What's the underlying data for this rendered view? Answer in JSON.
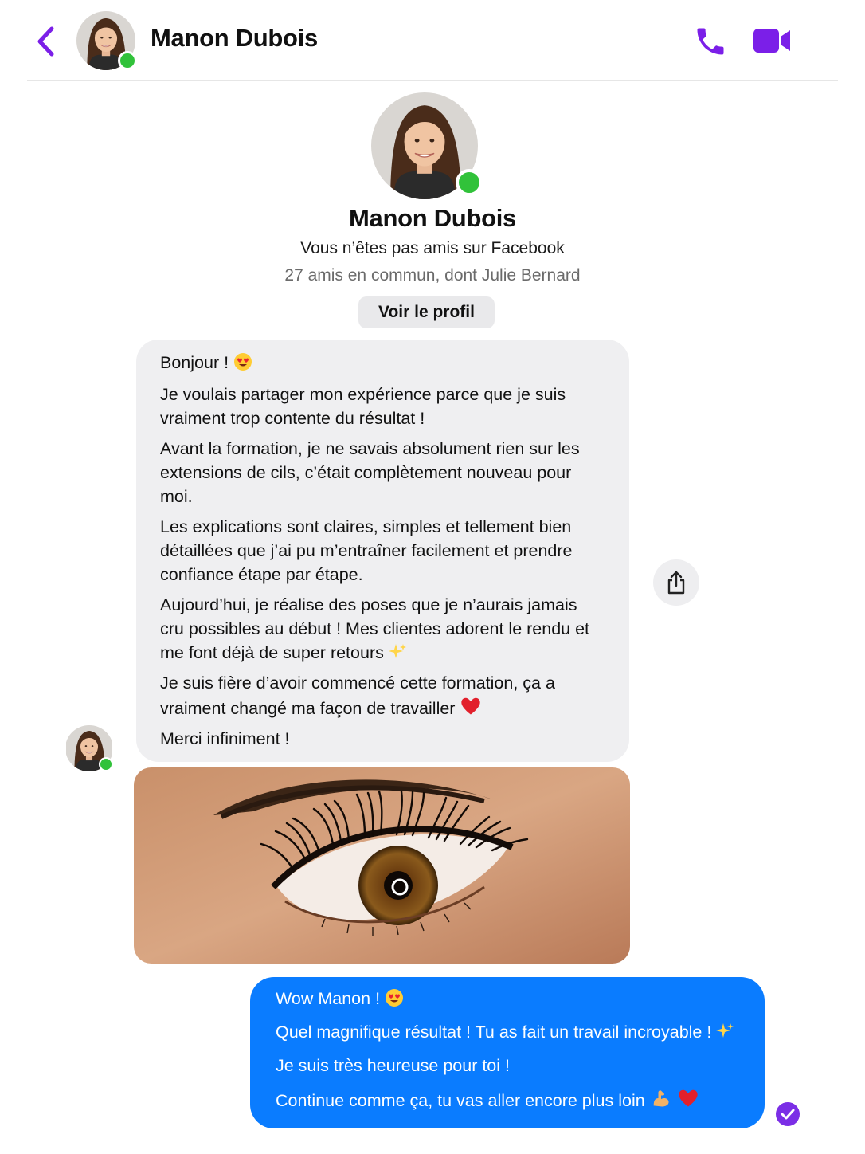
{
  "header": {
    "contact_name": "Manon Dubois",
    "back_icon": "chevron-left-icon",
    "call_icon": "phone-icon",
    "video_icon": "video-camera-icon",
    "accent_color": "#7b1fe8",
    "online_color": "#31c23a"
  },
  "profile": {
    "name": "Manon Dubois",
    "relationship": "Vous n’êtes pas amis sur Facebook",
    "mutual_friends": "27 amis en commun, dont Julie Bernard",
    "view_profile_label": "Voir le profil"
  },
  "incoming_message": {
    "lines": [
      "Bonjour !",
      "Je voulais partager mon expérience parce que je suis vraiment trop contente du résultat !",
      "Avant la formation, je ne savais absolument rien sur les extensions de cils, c’était complètement nouveau pour moi.",
      "Les explications sont claires, simples et tellement bien détaillées que j’ai pu m’entraîner facilement et prendre confiance étape par étape.",
      "Aujourd’hui, je réalise des poses que je n’aurais jamais cru possibles au début ! Mes clientes adorent le rendu et me font déjà de super retours",
      "Je suis fière d’avoir commencé cette formation, ça a vraiment changé ma façon de travailler",
      "Merci infiniment !"
    ],
    "bubble_color": "#efeff1",
    "attachment": "eyelash-extension-photo"
  },
  "share_button": {
    "icon": "share-icon"
  },
  "outgoing_message": {
    "lines": [
      "Wow Manon !",
      "Quel magnifique résultat ! Tu as fait un travail incroyable !",
      "Je suis très heureuse pour toi !",
      "Continue comme ça, tu vas aller encore plus loin"
    ],
    "bubble_color": "#0a7cff",
    "status_icon": "seen-check-icon"
  }
}
